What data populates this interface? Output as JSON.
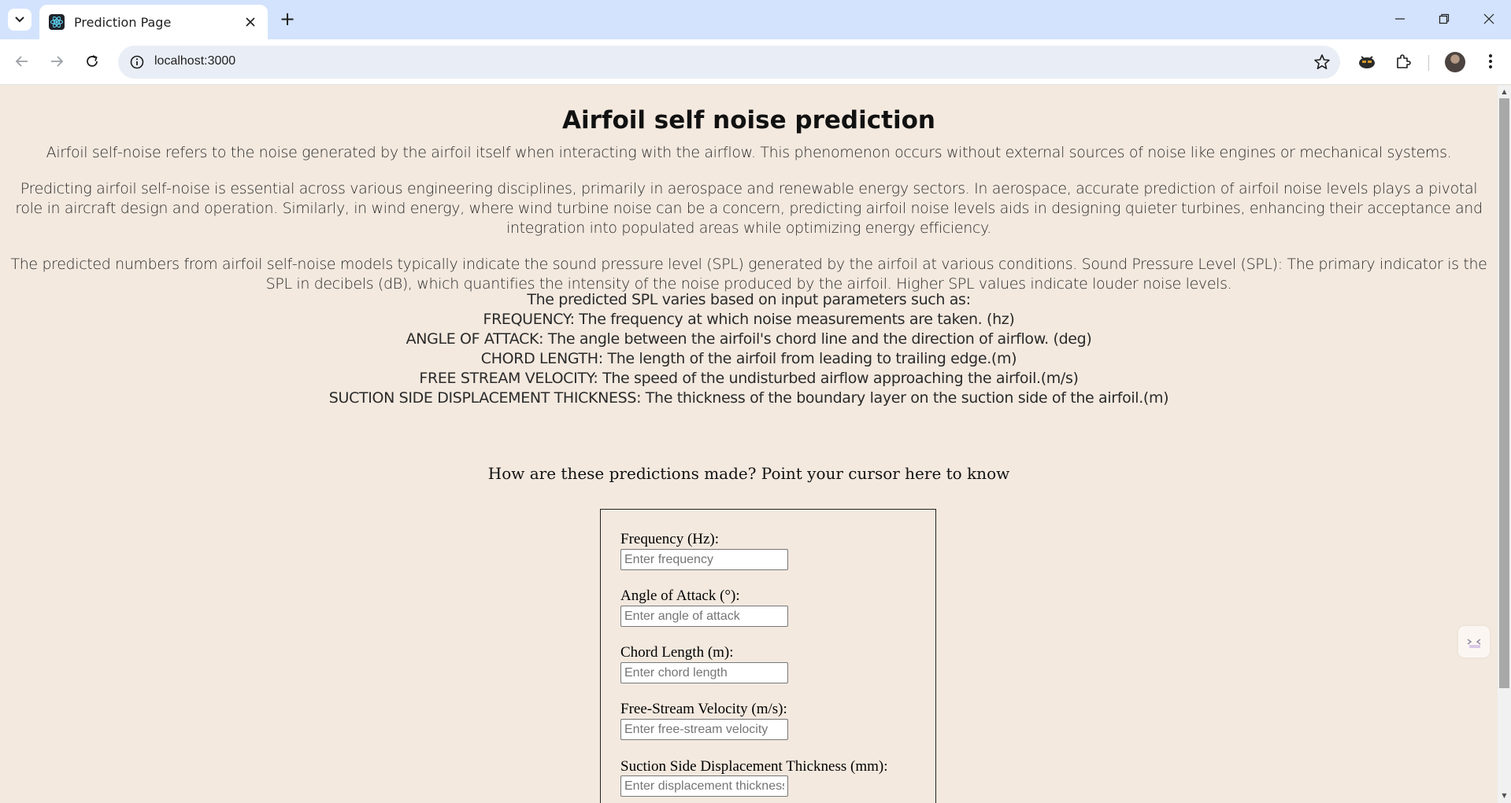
{
  "browser": {
    "tab_title": "Prediction Page",
    "url": "localhost:3000",
    "new_tab_symbol": "+",
    "icons": [
      "tab-search-icon",
      "react-favicon-icon",
      "close-icon",
      "minimize-icon",
      "restore-icon",
      "window-close-icon",
      "back-icon",
      "forward-icon",
      "reload-icon",
      "site-info-icon",
      "bookmark-star-icon",
      "extension-puzzle-icon",
      "profile-avatar",
      "menu-dots-icon"
    ]
  },
  "page": {
    "title": "Airfoil self noise prediction",
    "intro_1": "Airfoil self-noise refers to the noise generated by the airfoil itself when interacting with the airflow. This phenomenon occurs without external sources of noise like engines or mechanical systems.",
    "intro_2": "Predicting airfoil self-noise is essential across various engineering disciplines, primarily in aerospace and renewable energy sectors. In aerospace, accurate prediction of airfoil noise levels plays a pivotal role in aircraft design and operation. Similarly, in wind energy, where wind turbine noise can be a concern, predicting airfoil noise levels aids in designing quieter turbines, enhancing their acceptance and integration into populated areas while optimizing energy efficiency.",
    "intro_3": "The predicted numbers from airfoil self-noise models typically indicate the sound pressure level (SPL) generated by the airfoil at various conditions. Sound Pressure Level (SPL): The primary indicator is the SPL in decibels (dB), which quantifies the intensity of the noise produced by the airfoil. Higher SPL values indicate louder noise levels.",
    "params_intro": "The predicted SPL varies based on input parameters such as:",
    "params": [
      "FREQUENCY: The frequency at which noise measurements are taken. (hz)",
      "ANGLE OF ATTACK: The angle between the airfoil's chord line and the direction of airflow. (deg)",
      "CHORD LENGTH: The length of the airfoil from leading to trailing edge.(m)",
      "FREE STREAM VELOCITY: The speed of the undisturbed airflow approaching the airfoil.(m/s)",
      "SUCTION SIDE DISPLACEMENT THICKNESS: The thickness of the boundary layer on the suction side of the airfoil.(m)"
    ],
    "how_link": "How are these predictions made? Point your cursor here to know"
  },
  "form": {
    "fields": [
      {
        "label": "Frequency (Hz):",
        "placeholder": "Enter frequency",
        "value": ""
      },
      {
        "label": "Angle of Attack (°):",
        "placeholder": "Enter angle of attack",
        "value": ""
      },
      {
        "label": "Chord Length (m):",
        "placeholder": "Enter chord length",
        "value": ""
      },
      {
        "label": "Free-Stream Velocity (m/s):",
        "placeholder": "Enter free-stream velocity",
        "value": ""
      },
      {
        "label": "Suction Side Displacement Thickness (mm):",
        "placeholder": "Enter displacement thickness",
        "value": ""
      }
    ]
  },
  "colors": {
    "page_background": "#f3e9df",
    "tabbar": "#d3e3fd",
    "omnibox": "#e9eef6"
  }
}
